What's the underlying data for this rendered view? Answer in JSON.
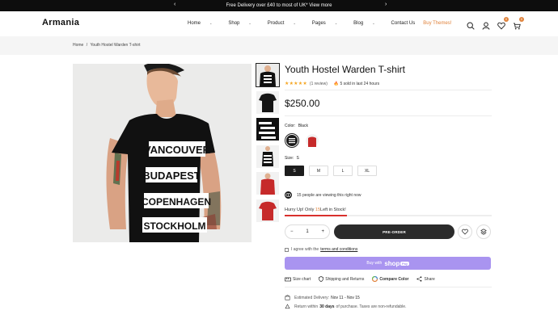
{
  "announcement": {
    "text": "Free Delivery over £40 to most of UK* View more",
    "prev_icon": "chevron-left-icon",
    "next_icon": "chevron-right-icon"
  },
  "header": {
    "logo": "Armania",
    "nav": [
      {
        "label": "Home",
        "has_dropdown": true
      },
      {
        "label": "Shop",
        "has_dropdown": true
      },
      {
        "label": "Product",
        "has_dropdown": true
      },
      {
        "label": "Pages",
        "has_dropdown": true
      },
      {
        "label": "Blog",
        "has_dropdown": true
      },
      {
        "label": "Contact Us",
        "has_dropdown": false
      },
      {
        "label": "Buy Themes!",
        "has_dropdown": false
      }
    ],
    "icons": [
      "search-icon",
      "user-icon",
      "heart-icon",
      "cart-icon"
    ],
    "wishlist_count": "0",
    "cart_count": "0"
  },
  "breadcrumb": {
    "home": "Home",
    "separator": "/",
    "current": "Youth Hostel Warden T-shirt"
  },
  "product": {
    "title": "Youth Hostel Warden T-shirt",
    "rating": 5,
    "stars": "★★★★★",
    "review_count": "(1 review)",
    "sold_text": "5 sold in last 24 hours",
    "price": "$250.00",
    "color_label": "Color:",
    "color_value": "Black",
    "size_label": "Size:",
    "size_value": "S",
    "sizes": [
      "S",
      "M",
      "L",
      "XL"
    ],
    "selected_size": "S",
    "shirt_words": [
      "VANCOUVER",
      "BUDAPEST",
      "COPENHAGEN",
      "STOCKHOLM"
    ],
    "viewing_text": "15 people are viewing this right now",
    "hurry_prefix": "Hurry Up! Only",
    "stock_count": "15",
    "hurry_suffix": "Left in Stock!",
    "stock_level": 0.3,
    "quantity": "1",
    "minus": "−",
    "plus": "+",
    "preorder_label": "PRE-ORDER",
    "agree_text": "I agree with the",
    "terms_link": "terms and conditions",
    "buy_with": "Buy with",
    "shop_word": "shop",
    "pay_word": "Pay",
    "size_chart": "Size chart",
    "shipping": "Shipping and Returns",
    "compare": "Compare Color",
    "share": "Share",
    "delivery_label": "Estimated Delivery:",
    "delivery_dates": "Nov 11 - Nov 15",
    "return_prefix": "Return within",
    "return_days": "30 days",
    "return_suffix": "of purchase. Taxes are non-refundable."
  },
  "colors": {
    "accent": "#e0823b",
    "stock_bar": "#d9302c",
    "shop_pay": "#a994f0",
    "star": "#f5a623"
  }
}
